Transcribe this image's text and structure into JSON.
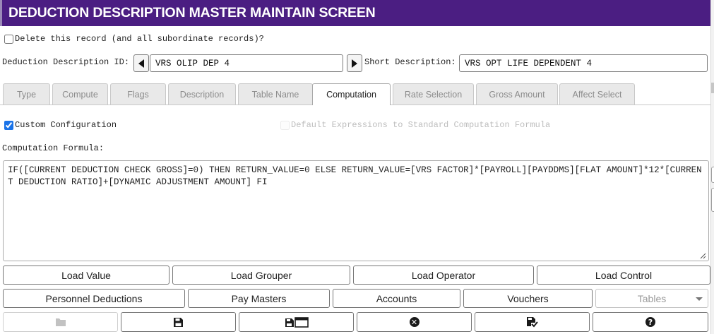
{
  "window": {
    "title": "DEDUCTION DESCRIPTION MASTER MAINTAIN SCREEN"
  },
  "delete_record": {
    "label": "Delete this record (and all subordinate records)?",
    "checked": false
  },
  "deduction_id": {
    "label": "Deduction Description ID:",
    "value": "VRS OLIP DEP 4"
  },
  "short_description": {
    "label": "Short Description:",
    "value": "VRS OPT LIFE DEPENDENT 4"
  },
  "tabs": [
    {
      "label": "Type",
      "active": false
    },
    {
      "label": "Compute",
      "active": false
    },
    {
      "label": "Flags",
      "active": false
    },
    {
      "label": "Description",
      "active": false
    },
    {
      "label": "Table Name",
      "active": false
    },
    {
      "label": "Computation",
      "active": true
    },
    {
      "label": "Rate Selection",
      "active": false
    },
    {
      "label": "Gross Amount",
      "active": false
    },
    {
      "label": "Affect Select",
      "active": false
    }
  ],
  "custom_configuration": {
    "label": "Custom Configuration",
    "checked": true
  },
  "default_expressions": {
    "label": "Default Expressions to Standard Computation Formula",
    "checked": false,
    "disabled": true
  },
  "computation_formula": {
    "label": "Computation Formula:",
    "value": "IF([CURRENT DEDUCTION CHECK GROSS]=0) THEN RETURN_VALUE=0 ELSE RETURN_VALUE=[VRS FACTOR]*[PAYROLL][PAYDDMS][FLAT AMOUNT]*12*[CURRENT DEDUCTION RATIO]+[DYNAMIC ADJUSTMENT AMOUNT] FI"
  },
  "load_buttons": [
    "Load Value",
    "Load Grouper",
    "Load Operator",
    "Load Control"
  ],
  "nav_buttons": [
    "Personnel Deductions",
    "Pay Masters",
    "Accounts",
    "Vouchers"
  ],
  "tables_select": {
    "label": "Tables",
    "disabled": true
  },
  "toolbar": [
    {
      "icon": "folder-icon",
      "disabled": true
    },
    {
      "icon": "save-icon",
      "disabled": false
    },
    {
      "icon": "save-to-window-icon",
      "disabled": false
    },
    {
      "icon": "close-circle-icon",
      "disabled": false
    },
    {
      "icon": "save-check-icon",
      "disabled": false
    },
    {
      "icon": "help-circle-icon",
      "disabled": false
    }
  ],
  "colors": {
    "title_bar": "#4b1e82",
    "title_text": "#ffffff",
    "check_accent": "#1a73e8"
  }
}
